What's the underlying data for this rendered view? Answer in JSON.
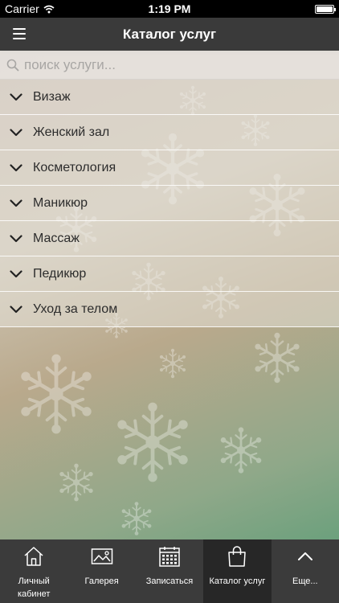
{
  "status_bar": {
    "carrier": "Carrier",
    "time": "1:19 PM"
  },
  "header": {
    "title": "Каталог услуг"
  },
  "search": {
    "placeholder": "поиск услуги..."
  },
  "services": [
    {
      "label": "Визаж"
    },
    {
      "label": "Женский зал"
    },
    {
      "label": "Косметология"
    },
    {
      "label": "Маникюр"
    },
    {
      "label": "Массаж"
    },
    {
      "label": "Педикюр"
    },
    {
      "label": "Уход за телом"
    }
  ],
  "tabs": [
    {
      "label": "Личный кабинет",
      "icon": "home-icon",
      "active": false
    },
    {
      "label": "Галерея",
      "icon": "gallery-icon",
      "active": false
    },
    {
      "label": "Записаться",
      "icon": "calendar-icon",
      "active": false
    },
    {
      "label": "Каталог услуг",
      "icon": "shopping-bag-icon",
      "active": true
    },
    {
      "label": "Еще...",
      "icon": "chevron-up-icon",
      "active": false
    }
  ],
  "colors": {
    "status_bar": "#000000",
    "nav_bar": "#3a3a3a",
    "tab_bar": "#3b3b3b",
    "tab_active": "#272727"
  }
}
